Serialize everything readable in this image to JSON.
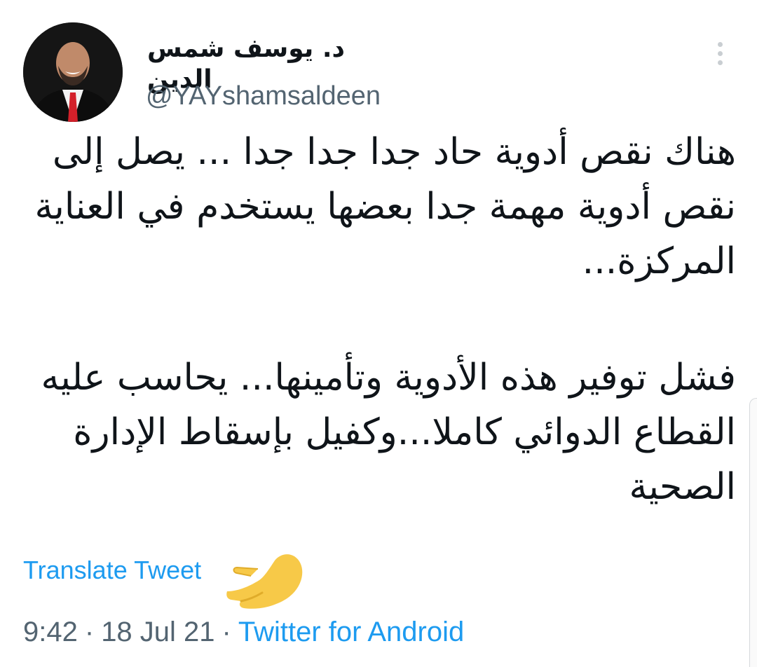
{
  "author": {
    "display_name": "د. يوسف شمس الدين",
    "handle": "@YAYshamsaldeen"
  },
  "tweet": {
    "paragraph_1": "هناك نقص أدوية حاد جدا جدا جدا ... يصل إلى نقص أدوية مهمة جدا بعضها يستخدم في العناية المركزة...",
    "paragraph_2": "فشل توفير هذه الأدوية وتأمينها... يحاسب عليه القطاع الدوائي كاملا...وكفيل بإسقاط الإدارة الصحية"
  },
  "translate_label": "Translate Tweet",
  "meta": {
    "time": "9:42",
    "separator": "·",
    "date": "18 Jul 21",
    "source": "Twitter for Android"
  },
  "colors": {
    "link": "#1d9bf0",
    "secondary_text": "#536471",
    "pointer_emoji": "#f7c948"
  },
  "icons": {
    "more": "more-vertical-icon",
    "pointer": "backhand-index-pointing-emoji"
  }
}
